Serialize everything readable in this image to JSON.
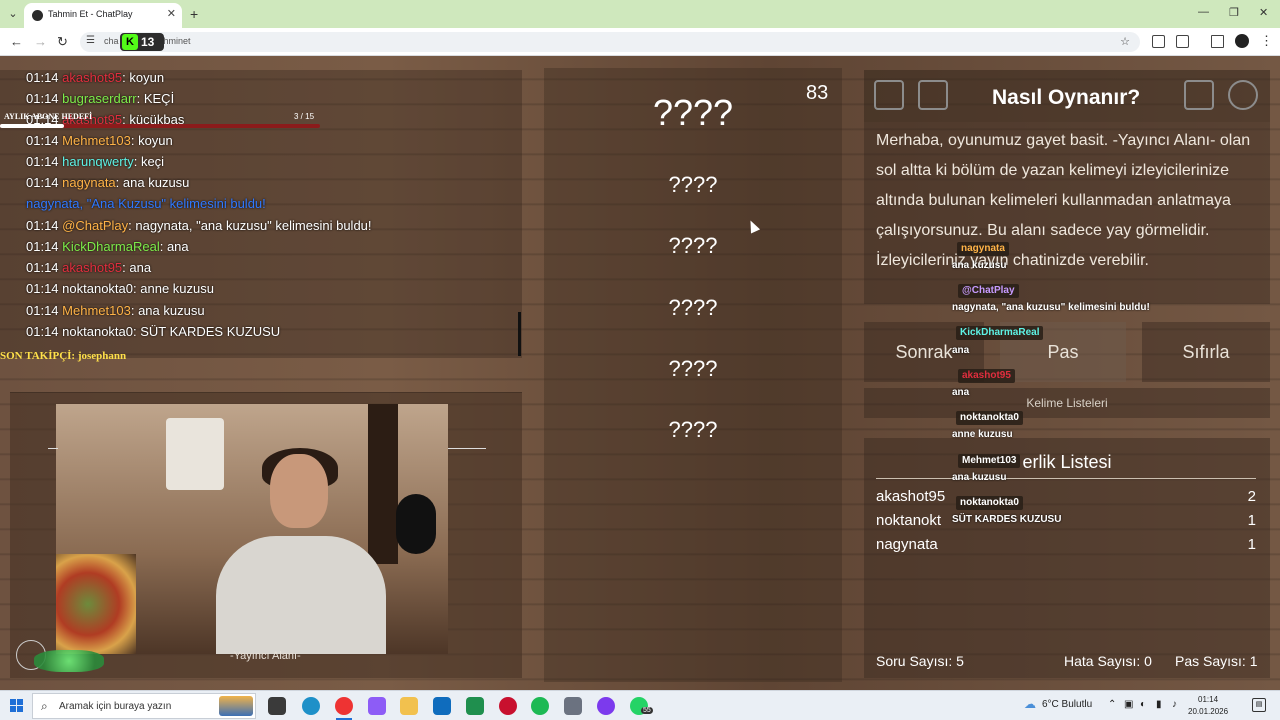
{
  "browser": {
    "tab_title": "Tahmin Et - ChatPlay",
    "url": "cha               r/games/tahminet",
    "overlay_badge": "13"
  },
  "chat": {
    "goal_label": "AYLIK ABONE HEDEFİ",
    "goal_count": "3  / 15",
    "goal_progress": 0.2,
    "lines": [
      {
        "time": "01:14",
        "user": "akashot95",
        "user_color": "red",
        "sep": ": ",
        "msg": "koyun"
      },
      {
        "time": "01:14",
        "user": "bugraserdarr",
        "user_color": "green",
        "sep": ": ",
        "msg": "KEÇİ"
      },
      {
        "time": "01:14",
        "user": "akashot95",
        "user_color": "red",
        "sep": ": ",
        "msg": "küçükbaş"
      },
      {
        "time": "01:14",
        "user": "Mehmet103",
        "user_color": "orange",
        "sep": ": ",
        "msg": "koyun"
      },
      {
        "time": "01:14",
        "user": "harunqwerty",
        "user_color": "cyan",
        "sep": ": ",
        "msg": "keçi"
      },
      {
        "time": "01:14",
        "user": "nagynata",
        "user_color": "orange",
        "sep": ": ",
        "msg": "ana kuzusu"
      },
      {
        "time": "",
        "user": "nagynata, \"Ana Kuzusu\" kelimesini buldu!",
        "user_color": "blue",
        "sep": "",
        "msg": ""
      },
      {
        "time": "01:14",
        "user": "@ChatPlay",
        "user_color": "orange",
        "sep": ": ",
        "msg": "nagynata, \"ana kuzusu\" kelimesini buldu!"
      },
      {
        "time": "01:14",
        "user": "KickDharmaReal",
        "user_color": "green",
        "sep": ": ",
        "msg": "ana"
      },
      {
        "time": "01:14",
        "user": "akashot95",
        "user_color": "red",
        "sep": ": ",
        "msg": "ana"
      },
      {
        "time": "01:14",
        "user": "noktanokta0",
        "user_color": "white",
        "sep": ": ",
        "msg": "anne kuzusu"
      },
      {
        "time": "01:14",
        "user": "Mehmet103",
        "user_color": "orange",
        "sep": ": ",
        "msg": "ana kuzusu"
      },
      {
        "time": "01:14",
        "user": "noktanokta0",
        "user_color": "white",
        "sep": ": ",
        "msg": "SÜT KARDES KUZUSU"
      }
    ],
    "last_follower": "SON TAKİPÇİ: josephann"
  },
  "webcam": {
    "caption": "-Yayıncı Alanı-"
  },
  "game": {
    "timer": "83",
    "slots": [
      "????",
      "????",
      "????",
      "????",
      "????",
      "????"
    ]
  },
  "panel": {
    "title": "Nasıl Oynanır?",
    "description": "Merhaba, oyunumuz gayet basit. -Yayıncı Alanı- olan sol altta ki bölüm de yazan kelimeyi izleyicilerinize altında bulunan kelimeleri kullanmadan anlatmaya çalışıyorsunuz. Bu alanı sadece yay   görmelidir. İzleyicileriniz yayın chatinizde         verebilir.",
    "buttons": {
      "next": "Sonrak",
      "pass": "Pas",
      "reset": "Sıfırla"
    },
    "word_lists": "Kelime Listeleri",
    "board_title": "   erlik Listesi",
    "leaderboard": [
      {
        "name": "akashot95",
        "score": "2"
      },
      {
        "name": "noktanokt",
        "score": "1"
      },
      {
        "name": "nagynata",
        "score": "1"
      }
    ],
    "footer": {
      "questions": "Soru Sayısı: 5",
      "errors": "Hata Sayısı: 0",
      "passes": "Pas Sayısı: 1"
    }
  },
  "floating_chat": [
    {
      "name": "nagynata",
      "name_color": "#ffb347",
      "msg": "ana kuzusu"
    },
    {
      "name": "@ChatPlay",
      "name_color": "#c79bff",
      "msg": "nagynata, \"ana kuzusu\" kelimesini buldu!"
    },
    {
      "name": "KickDharmaReal",
      "name_color": "#5ef3e6",
      "msg": "ana"
    },
    {
      "name": "akashot95",
      "name_color": "#e02e3e",
      "msg": "ana"
    },
    {
      "name": "noktanokta0",
      "name_color": "#ffffff",
      "msg": "anne kuzusu"
    },
    {
      "name": "Mehmet103",
      "name_color": "#ffffff",
      "msg": "ana kuzusu"
    },
    {
      "name": "noktanokta0",
      "name_color": "#ffffff",
      "msg": "SÜT KARDES KUZUSU"
    }
  ],
  "taskbar": {
    "search_placeholder": "Aramak için buraya yazın",
    "weather": "6°C  Bulutlu",
    "time": "01:14",
    "date": "20.01.2026",
    "whatsapp_badge": "55"
  },
  "colors": {
    "accent_green": "#53fc18",
    "user_red": "#e02e3e",
    "user_green": "#7dec4a",
    "user_orange": "#ffb347",
    "user_cyan": "#5ef3e6",
    "user_blue": "#2f78ff"
  }
}
